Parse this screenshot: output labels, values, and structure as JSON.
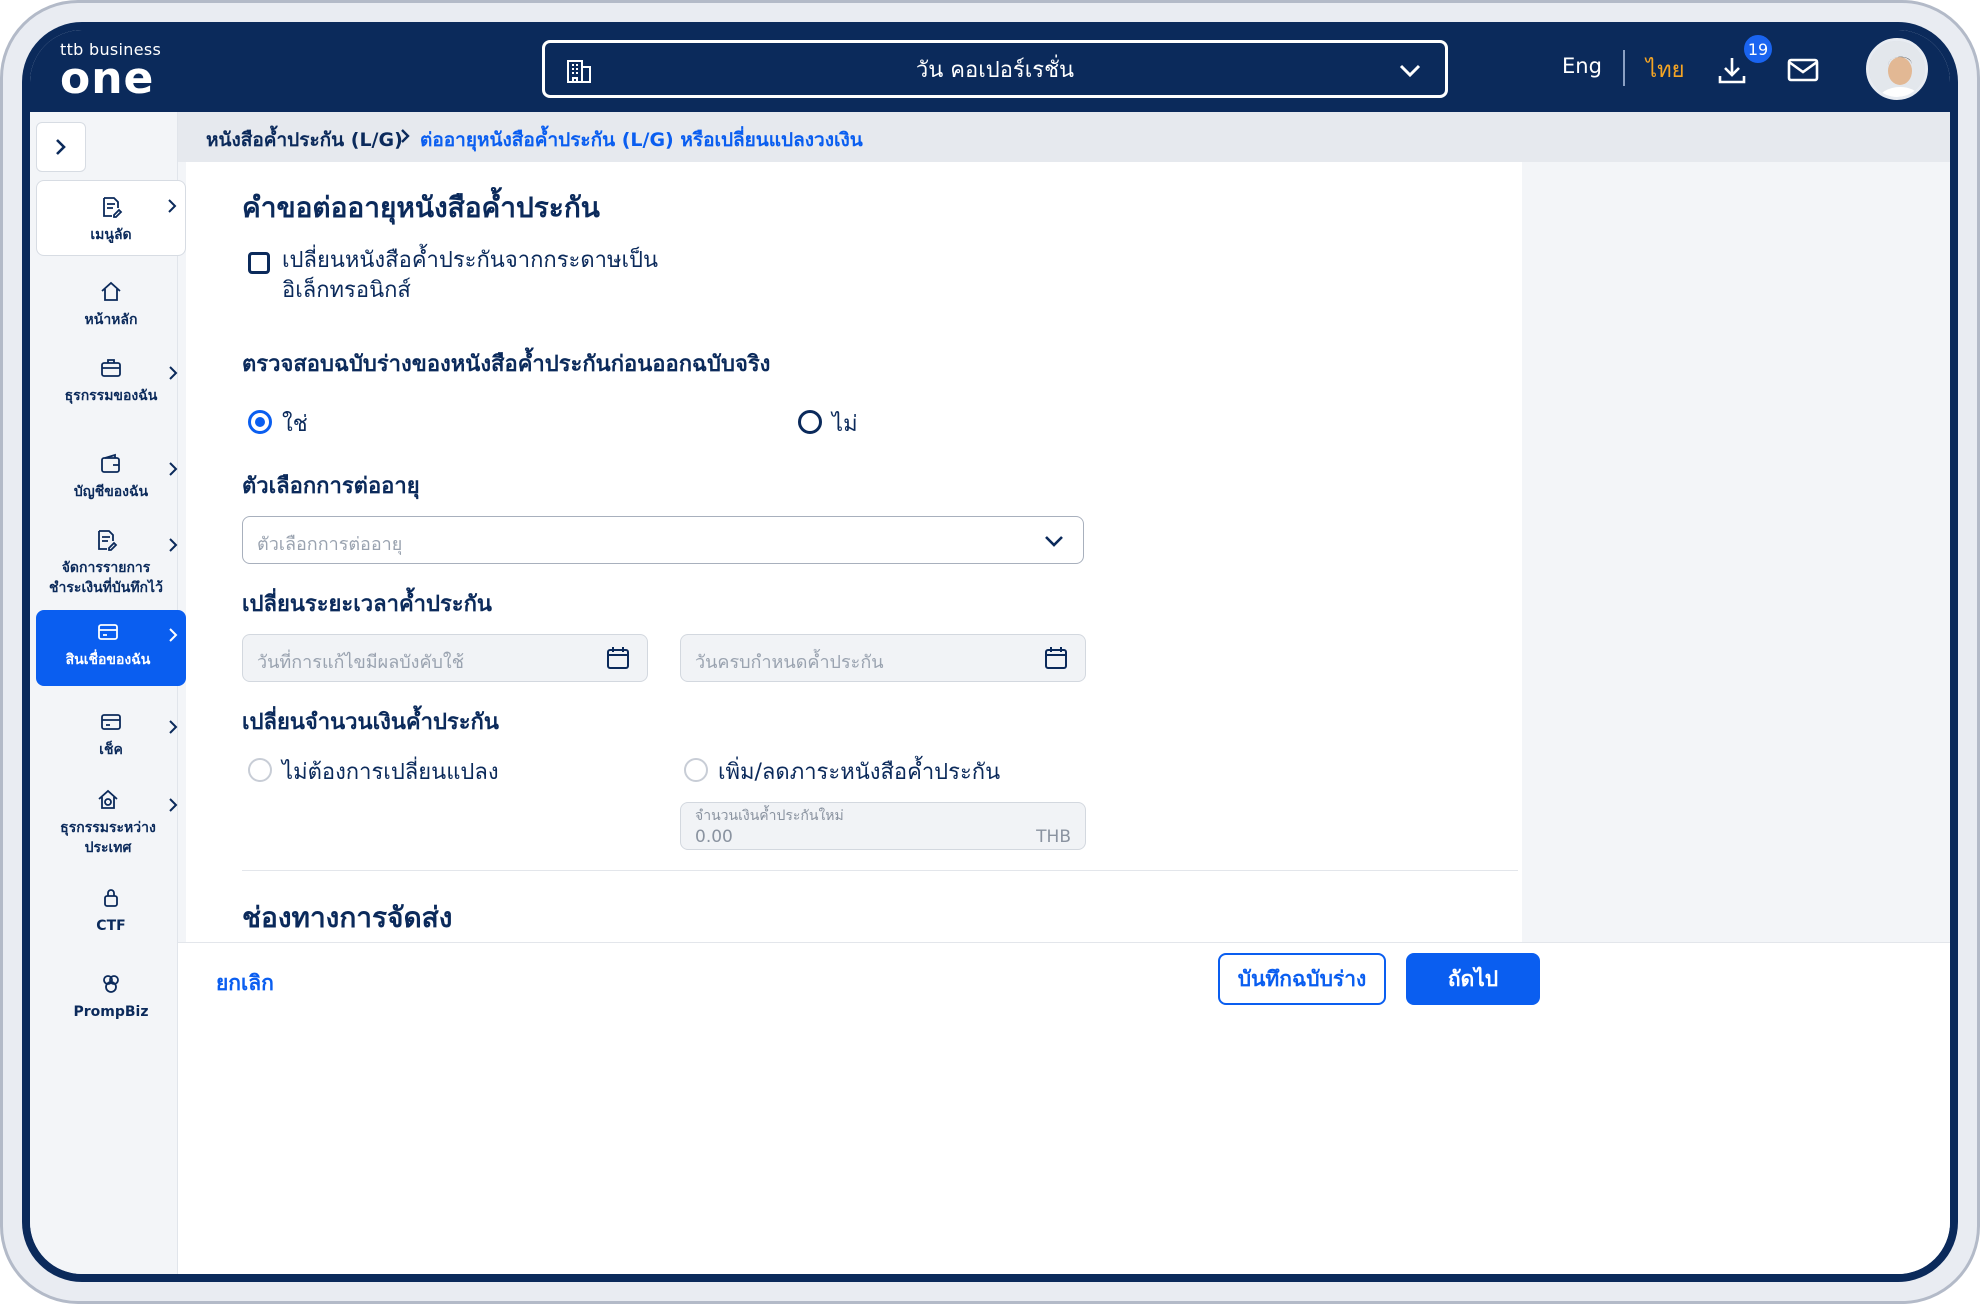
{
  "header": {
    "logo_small": "ttb business",
    "logo_big": "one",
    "company": "วัน คอเปอร์เรชั่น",
    "lang_eng": "Eng",
    "lang_th": "ไทย",
    "download_count": "19"
  },
  "sidebar": {
    "items": [
      {
        "label": "เมนูลัด"
      },
      {
        "label": "หน้าหลัก"
      },
      {
        "label": "ธุรกรรมของฉัน"
      },
      {
        "label": "บัญชีของฉัน"
      },
      {
        "label": "จัดการรายการชำระเงินที่บันทึกไว้"
      },
      {
        "label": "สินเชื่อของฉัน"
      },
      {
        "label": "เช็ค"
      },
      {
        "label": "ธุรกรรมระหว่างประเทศ"
      },
      {
        "label": "CTF"
      },
      {
        "label": "PrompBiz"
      }
    ]
  },
  "breadcrumb": {
    "parent": "หนังสือค้ำประกัน (L/G)",
    "current": "ต่ออายุหนังสือค้ำประกัน (L/G) หรือเปลี่ยนแปลงวงเงิน"
  },
  "form": {
    "title": "คำขอต่ออายุหนังสือค้ำประกัน",
    "convert_checkbox_label": "เปลี่ยนหนังสือค้ำประกันจากกระดาษเป็นอิเล็กทรอนิกส์",
    "draft_check_heading": "ตรวจสอบฉบับร่างของหนังสือค้ำประกันก่อนออกฉบับจริง",
    "radio_yes": "ใช่",
    "radio_no": "ไม่",
    "renew_option_heading": "ตัวเลือกการต่ออายุ",
    "renew_option_placeholder": "ตัวเลือกการต่ออายุ",
    "period_heading": "เปลี่ยนระยะเวลาค้ำประกัน",
    "effective_date_placeholder": "วันที่การแก้ไขมีผลบังคับใช้",
    "expiry_date_placeholder": "วันครบกำหนดค้ำประกัน",
    "amount_heading": "เปลี่ยนจำนวนเงินค้ำประกัน",
    "amount_no_change": "ไม่ต้องการเปลี่ยนแปลง",
    "amount_change": "เพิ่ม/ลดภาระหนังสือค้ำประกัน",
    "new_amount_label": "จำนวนเงินค้ำประกันใหม่",
    "new_amount_value": "0.00",
    "currency": "THB",
    "delivery_heading": "ช่องทางการจัดส่ง"
  },
  "footer": {
    "cancel": "ยกเลิก",
    "save_draft": "บันทึกฉบับร่าง",
    "next": "ถัดไป"
  },
  "colors": {
    "navy": "#0b2a5b",
    "primary": "#0a5ef0",
    "accent_orange": "#f5a524"
  }
}
